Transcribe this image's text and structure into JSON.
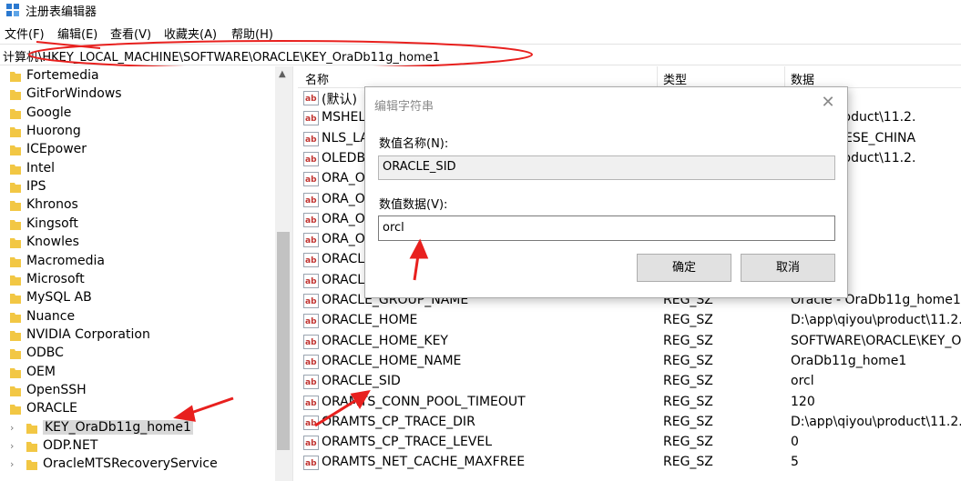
{
  "window": {
    "title": "注册表编辑器",
    "icon": "regedit-icon"
  },
  "menu": {
    "items": [
      "文件(F)",
      "编辑(E)",
      "查看(V)",
      "收藏夹(A)",
      "帮助(H)"
    ]
  },
  "address": {
    "path": "计算机\\HKEY_LOCAL_MACHINE\\SOFTWARE\\ORACLE\\KEY_OraDb11g_home1"
  },
  "tree": {
    "items": [
      {
        "label": "Fortemedia",
        "expandable": false,
        "selected": false
      },
      {
        "label": "GitForWindows",
        "expandable": false,
        "selected": false
      },
      {
        "label": "Google",
        "expandable": false,
        "selected": false
      },
      {
        "label": "Huorong",
        "expandable": false,
        "selected": false
      },
      {
        "label": "ICEpower",
        "expandable": false,
        "selected": false
      },
      {
        "label": "Intel",
        "expandable": false,
        "selected": false
      },
      {
        "label": "IPS",
        "expandable": false,
        "selected": false
      },
      {
        "label": "Khronos",
        "expandable": false,
        "selected": false
      },
      {
        "label": "Kingsoft",
        "expandable": false,
        "selected": false
      },
      {
        "label": "Knowles",
        "expandable": false,
        "selected": false
      },
      {
        "label": "Macromedia",
        "expandable": false,
        "selected": false
      },
      {
        "label": "Microsoft",
        "expandable": false,
        "selected": false
      },
      {
        "label": "MySQL AB",
        "expandable": false,
        "selected": false
      },
      {
        "label": "Nuance",
        "expandable": false,
        "selected": false
      },
      {
        "label": "NVIDIA Corporation",
        "expandable": false,
        "selected": false
      },
      {
        "label": "ODBC",
        "expandable": false,
        "selected": false
      },
      {
        "label": "OEM",
        "expandable": false,
        "selected": false
      },
      {
        "label": "OpenSSH",
        "expandable": false,
        "selected": false
      },
      {
        "label": "ORACLE",
        "expandable": false,
        "selected": false
      },
      {
        "label": "KEY_OraDb11g_home1",
        "expandable": true,
        "selected": true
      },
      {
        "label": "ODP.NET",
        "expandable": true,
        "selected": false
      },
      {
        "label": "OracleMTSRecoveryService",
        "expandable": true,
        "selected": false
      }
    ]
  },
  "list": {
    "columns": {
      "name": "名称",
      "type": "类型",
      "data": "数据"
    },
    "rows": [
      {
        "name": "(默认)",
        "type": "",
        "data": "置)"
      },
      {
        "name": "MSHEL",
        "type": "",
        "data": "qiyou\\product\\11.2."
      },
      {
        "name": "NLS_LA",
        "type": "",
        "data": "ED CHINESE_CHINA"
      },
      {
        "name": "OLEDB",
        "type": "",
        "data": "qiyou\\product\\11.2."
      },
      {
        "name": "ORA_O",
        "type": "",
        "data": ""
      },
      {
        "name": "ORA_O",
        "type": "",
        "data": ""
      },
      {
        "name": "ORA_O",
        "type": "",
        "data": ""
      },
      {
        "name": "ORA_O",
        "type": "",
        "data": "te"
      },
      {
        "name": "ORACL",
        "type": "",
        "data": "qiyou"
      },
      {
        "name": "ORACL",
        "type": "",
        "data": "e"
      },
      {
        "name": "ORACLE_GROUP_NAME",
        "type": "REG_SZ",
        "data": "Oracle - OraDb11g_home1"
      },
      {
        "name": "ORACLE_HOME",
        "type": "REG_SZ",
        "data": "D:\\app\\qiyou\\product\\11.2."
      },
      {
        "name": "ORACLE_HOME_KEY",
        "type": "REG_SZ",
        "data": "SOFTWARE\\ORACLE\\KEY_Or"
      },
      {
        "name": "ORACLE_HOME_NAME",
        "type": "REG_SZ",
        "data": "OraDb11g_home1"
      },
      {
        "name": "ORACLE_SID",
        "type": "REG_SZ",
        "data": "orcl"
      },
      {
        "name": "ORAMTS_CONN_POOL_TIMEOUT",
        "type": "REG_SZ",
        "data": "120"
      },
      {
        "name": "ORAMTS_CP_TRACE_DIR",
        "type": "REG_SZ",
        "data": "D:\\app\\qiyou\\product\\11.2."
      },
      {
        "name": "ORAMTS_CP_TRACE_LEVEL",
        "type": "REG_SZ",
        "data": "0"
      },
      {
        "name": "ORAMTS_NET_CACHE_MAXFREE",
        "type": "REG_SZ",
        "data": "5"
      }
    ]
  },
  "dialog": {
    "title": "编辑字符串",
    "value_name_label": "数值名称(N):",
    "value_name": "ORACLE_SID",
    "value_data_label": "数值数据(V):",
    "value_data": "orcl",
    "ok_label": "确定",
    "cancel_label": "取消"
  },
  "annotation_color": "#e8201e",
  "folder_color": "#f2c744"
}
